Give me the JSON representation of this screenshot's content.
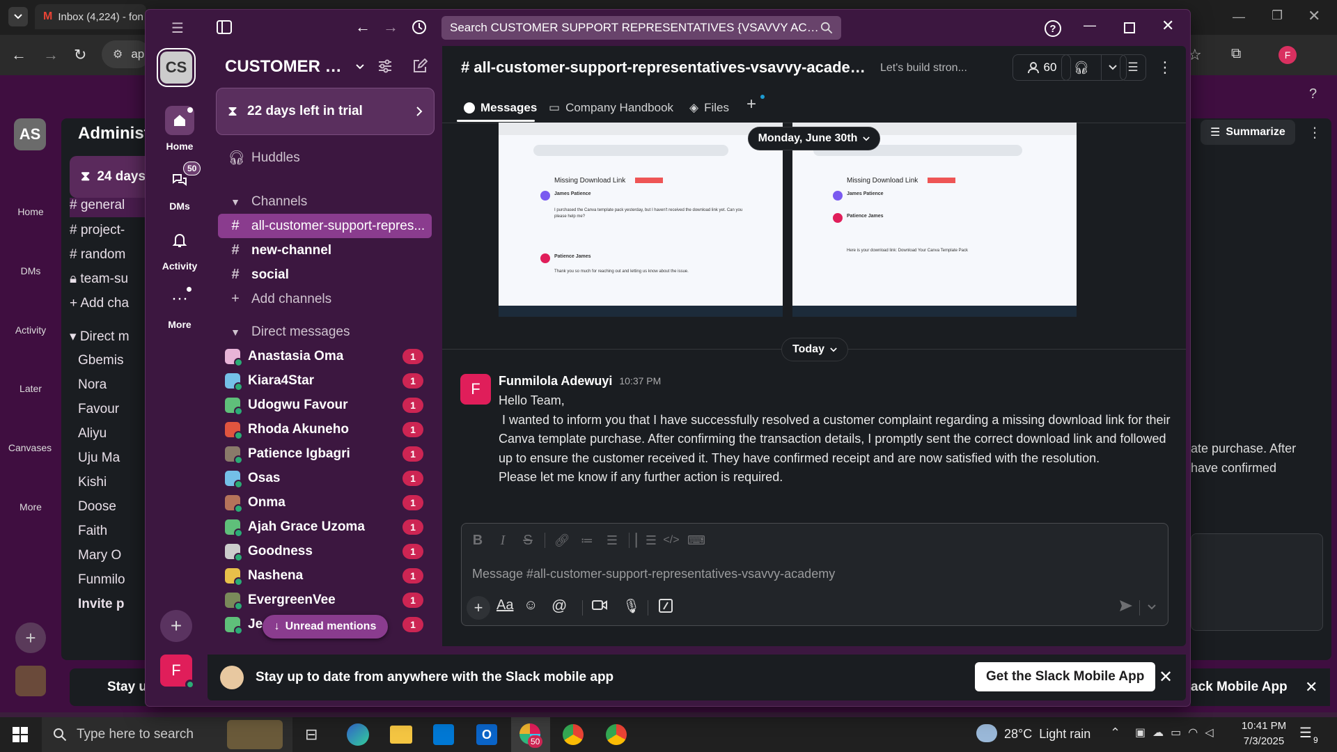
{
  "browser": {
    "tab_title": "Inbox (4,224) - fon",
    "url_fragment": "ap",
    "profile_initial": "F"
  },
  "bg_slack": {
    "workspace_initials": "AS",
    "workspace_name": "Administ",
    "trial_fragment": "24 days",
    "rail": [
      "Home",
      "DMs",
      "Activity",
      "Later",
      "Canvases",
      "More"
    ],
    "channels": [
      "general",
      "project-",
      "random",
      "team-su",
      "Add cha"
    ],
    "direct_label": "Direct m",
    "dms": [
      "Gbemis",
      "Nora",
      "Favour",
      "Aliyu",
      "Uju Ma",
      "Kishi",
      "Doose",
      "Faith",
      "Mary O",
      "Funmilo",
      "Invite p"
    ],
    "summarize": "Summarize",
    "msg_fragment_1": "ate purchase. After",
    "msg_fragment_2": "have confirmed",
    "banner_fragment": "Stay up",
    "banner_button_fragment": "ack Mobile App"
  },
  "window": {
    "search_placeholder": "Search CUSTOMER SUPPORT REPRESENTATIVES {VSAVVY ACADEM..."
  },
  "rail": {
    "workspace_initials": "CS",
    "home": "Home",
    "dms": "DMs",
    "dms_badge": "50",
    "activity": "Activity",
    "more": "More",
    "user_initial": "F"
  },
  "sidebar": {
    "workspace_name": "CUSTOMER S...",
    "trial": "22 days left in trial",
    "huddles": "Huddles",
    "channels_header": "Channels",
    "channels": [
      {
        "name": "all-customer-support-repres...",
        "active": true
      },
      {
        "name": "new-channel",
        "active": false
      },
      {
        "name": "social",
        "active": false
      }
    ],
    "add_channels": "Add channels",
    "dm_header": "Direct messages",
    "dms": [
      {
        "name": "Anastasia Oma",
        "badge": "1",
        "color": "#e8b4d8"
      },
      {
        "name": "Kiara4Star",
        "badge": "1",
        "color": "#74c0e8"
      },
      {
        "name": "Udogwu Favour",
        "badge": "1",
        "color": "#5fbf7a"
      },
      {
        "name": "Rhoda Akuneho",
        "badge": "1",
        "color": "#e0553f"
      },
      {
        "name": "Patience Igbagri",
        "badge": "1",
        "color": "#8a7a6a"
      },
      {
        "name": "Osas",
        "badge": "1",
        "color": "#74c0e8"
      },
      {
        "name": "Onma",
        "badge": "1",
        "color": "#b5735a"
      },
      {
        "name": "Ajah Grace Uzoma",
        "badge": "1",
        "color": "#5fbf7a"
      },
      {
        "name": "Goodness",
        "badge": "1",
        "color": "#cccccc"
      },
      {
        "name": "Nashena",
        "badge": "1",
        "color": "#e8c04a"
      },
      {
        "name": "EvergreenVee",
        "badge": "1",
        "color": "#7a8a5a"
      },
      {
        "name": "Je",
        "badge": "1",
        "color": "#5fbf7a"
      }
    ],
    "unread_mentions": "Unread mentions"
  },
  "channel": {
    "name": "# all-customer-support-representatives-vsavvy-academy",
    "topic": "Let's build stron...",
    "member_count": "60",
    "tabs": [
      "Messages",
      "Company Handbook",
      "Files"
    ]
  },
  "messages": {
    "date_divider_1": "Monday, June 30th",
    "date_divider_2": "Today",
    "author": "Funmilola Adewuyi",
    "time": "10:37 PM",
    "avatar_initial": "F",
    "lines": [
      "Hello Team,",
      " I wanted to inform you that I have successfully resolved a customer complaint regarding a missing download link for their Canva template purchase. After confirming the transaction details, I promptly sent the correct download link and followed up to ensure the customer received it. They have confirmed receipt and are now satisfied with the resolution.",
      "Please let me know if any further action is required."
    ],
    "attachment_1": {
      "subject": "Missing Download Link",
      "sender_1": "James Patience",
      "text_1": "I purchased the Canva template pack yesterday, but I haven't received the download link yet. Can you please help me?",
      "sender_2": "Patience James",
      "text_2": "Thank you so much for reaching out and letting us know about the issue."
    },
    "attachment_2": {
      "subject": "Missing Download Link",
      "sender_1": "James Patience",
      "sender_2": "Patience James",
      "text_2": "Here is your download link: Download Your Canva Template Pack"
    }
  },
  "composer": {
    "placeholder": "Message #all-customer-support-representatives-vsavvy-academy"
  },
  "banner": {
    "text": "Stay up to date from anywhere with the Slack mobile app",
    "button": "Get the Slack Mobile App"
  },
  "taskbar": {
    "search_placeholder": "Type here to search",
    "weather": "28°C  Light rain",
    "time": "10:41 PM",
    "date": "7/3/2025",
    "notif_count": "9",
    "slack_badge": "50"
  },
  "colors": {
    "aubergine": "#3c1740",
    "accent_purple": "#8a3c8e",
    "badge_red": "#cd2553",
    "presence_green": "#2bac76"
  }
}
